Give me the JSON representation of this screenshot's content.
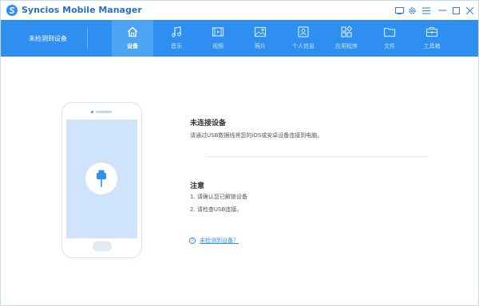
{
  "window": {
    "title": "Syncios Mobile Manager",
    "controls": [
      {
        "name": "feedback-icon",
        "glyph": "▭"
      },
      {
        "name": "settings-icon",
        "glyph": "⚙"
      },
      {
        "name": "menu-icon",
        "glyph": "≡"
      },
      {
        "name": "minimize-icon",
        "glyph": "—"
      },
      {
        "name": "maximize-icon",
        "glyph": "□"
      },
      {
        "name": "close-icon",
        "glyph": "✕"
      }
    ]
  },
  "colors": {
    "accent": "#2f8ff0",
    "active_tab": "#4fa3f3",
    "screen": "#cfe3fb"
  },
  "nav": {
    "device_status": "未检测到设备",
    "tabs": [
      {
        "id": "device",
        "label": "设备",
        "icon": "home-icon",
        "active": true
      },
      {
        "id": "music",
        "label": "音乐",
        "icon": "music-icon",
        "active": false
      },
      {
        "id": "video",
        "label": "视频",
        "icon": "video-icon",
        "active": false
      },
      {
        "id": "photo",
        "label": "照片",
        "icon": "photo-icon",
        "active": false
      },
      {
        "id": "info",
        "label": "个人信息",
        "icon": "contact-icon",
        "active": false
      },
      {
        "id": "apps",
        "label": "应用程序",
        "icon": "apps-icon",
        "active": false
      },
      {
        "id": "files",
        "label": "文件",
        "icon": "folder-icon",
        "active": false
      },
      {
        "id": "toolbox",
        "label": "工具箱",
        "icon": "toolbox-icon",
        "active": false
      }
    ]
  },
  "main": {
    "no_device_title": "未连接设备",
    "no_device_desc": "请通过USB数据线将您的iOS或安卓设备连接到电脑。",
    "note_title": "注意",
    "notes": [
      "1. 请确认您已解锁设备",
      "2. 请检查USB连接。"
    ],
    "help_link": "未检测到设备？"
  }
}
